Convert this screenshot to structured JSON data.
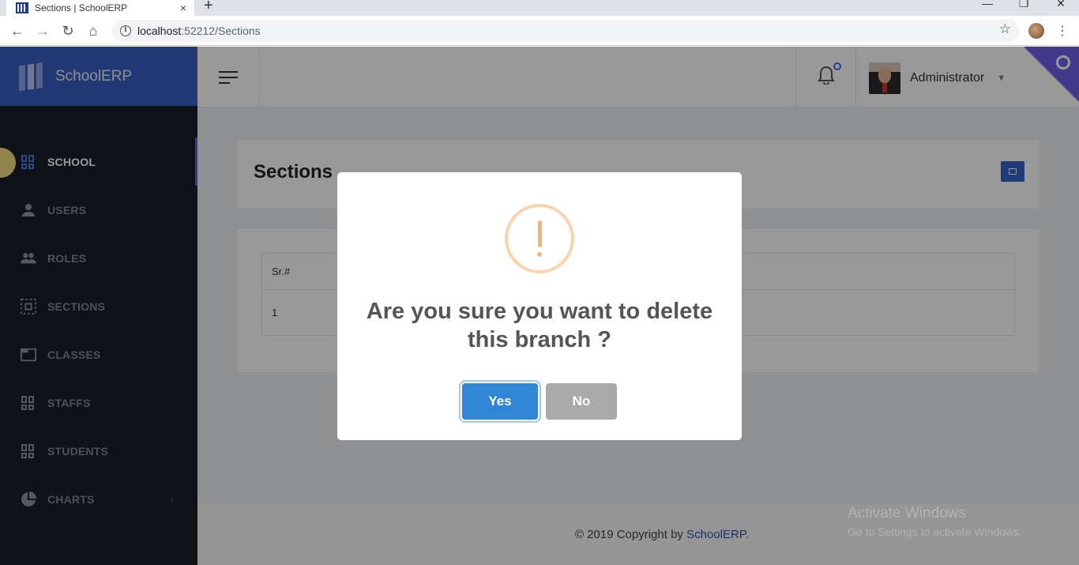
{
  "browser": {
    "tab_title": "Sections | SchoolERP",
    "tab_close": "×",
    "new_tab": "+",
    "url_host": "localhost",
    "url_rest": ":52212/Sections",
    "controls": {
      "minimize": "—",
      "maximize": "❐",
      "close": "✕"
    }
  },
  "sidebar": {
    "brand": "SchoolERP",
    "items": [
      {
        "label": "SCHOOL",
        "icon": "dashboard-grid-icon",
        "active": true
      },
      {
        "label": "USERS",
        "icon": "person-icon"
      },
      {
        "label": "ROLES",
        "icon": "people-icon"
      },
      {
        "label": "SECTIONS",
        "icon": "select-frame-icon"
      },
      {
        "label": "CLASSES",
        "icon": "window-icon"
      },
      {
        "label": "STAFFS",
        "icon": "dashboard-grid-icon"
      },
      {
        "label": "STUDENTS",
        "icon": "dashboard-grid-icon"
      },
      {
        "label": "CHARTS",
        "icon": "pie-chart-icon",
        "has_submenu": true
      }
    ]
  },
  "header": {
    "username": "Administrator"
  },
  "page": {
    "title": "Sections",
    "table": {
      "columns": [
        "Sr.#"
      ],
      "rows": [
        [
          "1"
        ]
      ]
    }
  },
  "footer": {
    "text": "© 2019 Copyright by ",
    "link": "SchoolERP",
    "suffix": "."
  },
  "watermark": {
    "line1": "Activate Windows",
    "line2": "Go to Settings to activate Windows."
  },
  "modal": {
    "title": "Are you sure you want to delete this branch ?",
    "yes_label": "Yes",
    "no_label": "No"
  },
  "colors": {
    "brand": "#3b5fc4",
    "sidebar": "#1a1f2b",
    "confirm": "#3085d6",
    "cancel": "#aaaaaa",
    "warning": "#f8bb86"
  }
}
